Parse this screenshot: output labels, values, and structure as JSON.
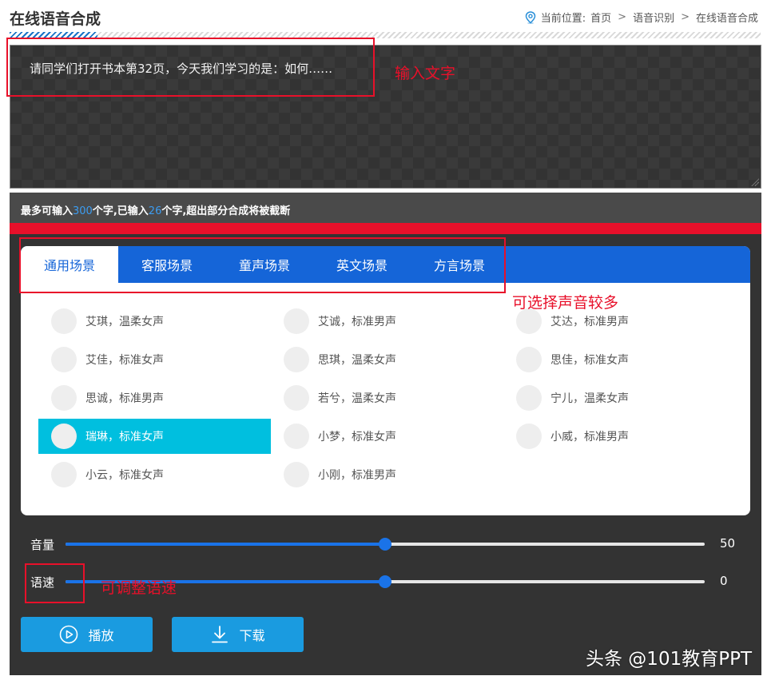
{
  "header": {
    "title": "在线语音合成",
    "breadcrumb": {
      "prefix": "当前位置:",
      "items": [
        "首页",
        "语音识别",
        "在线语音合成"
      ],
      "separator": ">"
    }
  },
  "text_input": {
    "value": "请同学们打开书本第32页，今天我们学习的是：如何……"
  },
  "info_bar": {
    "part1": "最多可输入",
    "max": "300",
    "part2": "个字,已输入",
    "entered": "26",
    "part3": "个字,超出部分合成将被截断"
  },
  "tabs": [
    {
      "label": "通用场景",
      "active": true
    },
    {
      "label": "客服场景",
      "active": false
    },
    {
      "label": "童声场景",
      "active": false
    },
    {
      "label": "英文场景",
      "active": false
    },
    {
      "label": "方言场景",
      "active": false
    }
  ],
  "voices": [
    {
      "label": "艾琪，温柔女声",
      "selected": false
    },
    {
      "label": "艾诚，标准男声",
      "selected": false
    },
    {
      "label": "艾达，标准男声",
      "selected": false
    },
    {
      "label": "艾佳，标准女声",
      "selected": false
    },
    {
      "label": "思琪，温柔女声",
      "selected": false
    },
    {
      "label": "思佳，标准女声",
      "selected": false
    },
    {
      "label": "思诚，标准男声",
      "selected": false
    },
    {
      "label": "若兮，温柔女声",
      "selected": false
    },
    {
      "label": "宁儿，温柔女声",
      "selected": false
    },
    {
      "label": "瑞琳，标准女声",
      "selected": true
    },
    {
      "label": "小梦，标准女声",
      "selected": false
    },
    {
      "label": "小威，标准男声",
      "selected": false
    },
    {
      "label": "小云，标准女声",
      "selected": false
    },
    {
      "label": "小刚，标准男声",
      "selected": false
    }
  ],
  "volume": {
    "label": "音量",
    "value": "50",
    "fraction": 0.5
  },
  "speed": {
    "label": "语速",
    "value": "0",
    "fraction": 0.5
  },
  "buttons": {
    "play": "播放",
    "download": "下载"
  },
  "annotations": {
    "input_text": "输入文字",
    "many_voices": "可选择声音较多",
    "adjust_speed": "可调整语速"
  },
  "watermark": "头条 @101教育PPT",
  "colors": {
    "tab_blue": "#1565d8",
    "selected_voice": "#00bfdf",
    "accent_red": "#e8102a",
    "button_blue": "#1a9be0",
    "count_blue": "#3c9cf0"
  }
}
